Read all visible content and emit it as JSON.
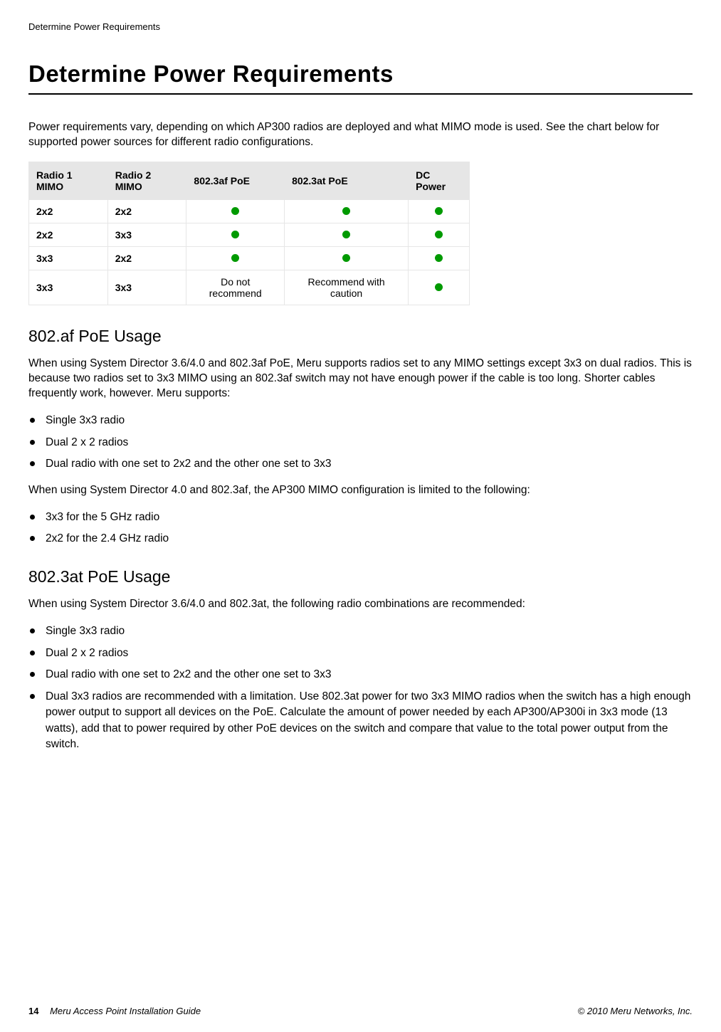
{
  "header": {
    "running": "Determine Power Requirements"
  },
  "title": "Determine Power Requirements",
  "intro": "Power requirements vary, depending on which AP300 radios are deployed and what MIMO mode is used. See the chart below for supported power sources for different radio configurations.",
  "table": {
    "headers": {
      "c1": "Radio 1 MIMO",
      "c2": "Radio 2 MIMO",
      "c3": "802.3af PoE",
      "c4": "802.3at PoE",
      "c5": "DC Power"
    },
    "rows": [
      {
        "r1": "2x2",
        "r2": "2x2",
        "af": "dot",
        "at": "dot",
        "dc": "dot"
      },
      {
        "r1": "2x2",
        "r2": "3x3",
        "af": "dot",
        "at": "dot",
        "dc": "dot"
      },
      {
        "r1": "3x3",
        "r2": "2x2",
        "af": "dot",
        "at": "dot",
        "dc": "dot"
      },
      {
        "r1": "3x3",
        "r2": "3x3",
        "af": "Do not recommend",
        "at": "Recommend with caution",
        "dc": "dot"
      }
    ]
  },
  "sections": {
    "af": {
      "title": "802.af PoE Usage",
      "p1": "When using System Director 3.6/4.0 and 802.3af PoE, Meru supports radios set to any MIMO settings except 3x3 on dual radios. This is because two radios set to 3x3 MIMO using an 802.3af switch may not have enough power if the cable is too long. Shorter cables frequently work, however. Meru supports:",
      "list1": [
        "Single 3x3 radio",
        "Dual 2 x 2 radios",
        "Dual radio with one set to 2x2 and the other one set to 3x3"
      ],
      "p2": "When using System Director 4.0 and 802.3af, the AP300 MIMO configuration is limited to the following:",
      "list2": [
        "3x3 for the 5 GHz radio",
        "2x2 for the 2.4 GHz radio"
      ]
    },
    "at": {
      "title": "802.3at PoE Usage",
      "p1": "When using System Director 3.6/4.0 and 802.3at, the following radio combinations are recommended:",
      "list1": [
        "Single 3x3 radio",
        "Dual 2 x 2 radios",
        "Dual radio with one set to 2x2 and the other one set to 3x3",
        "Dual 3x3 radios are recommended with a limitation. Use 802.3at power for two 3x3 MIMO radios when the switch has a high enough power output to support all devices on the PoE. Calculate the amount of power needed by each AP300/AP300i in 3x3 mode (13 watts), add that to power required by other PoE devices on the switch and compare that value to the total power output from the switch."
      ]
    }
  },
  "footer": {
    "pagenum": "14",
    "doc": "Meru Access Point Installation Guide",
    "copyright": "© 2010 Meru Networks, Inc."
  }
}
